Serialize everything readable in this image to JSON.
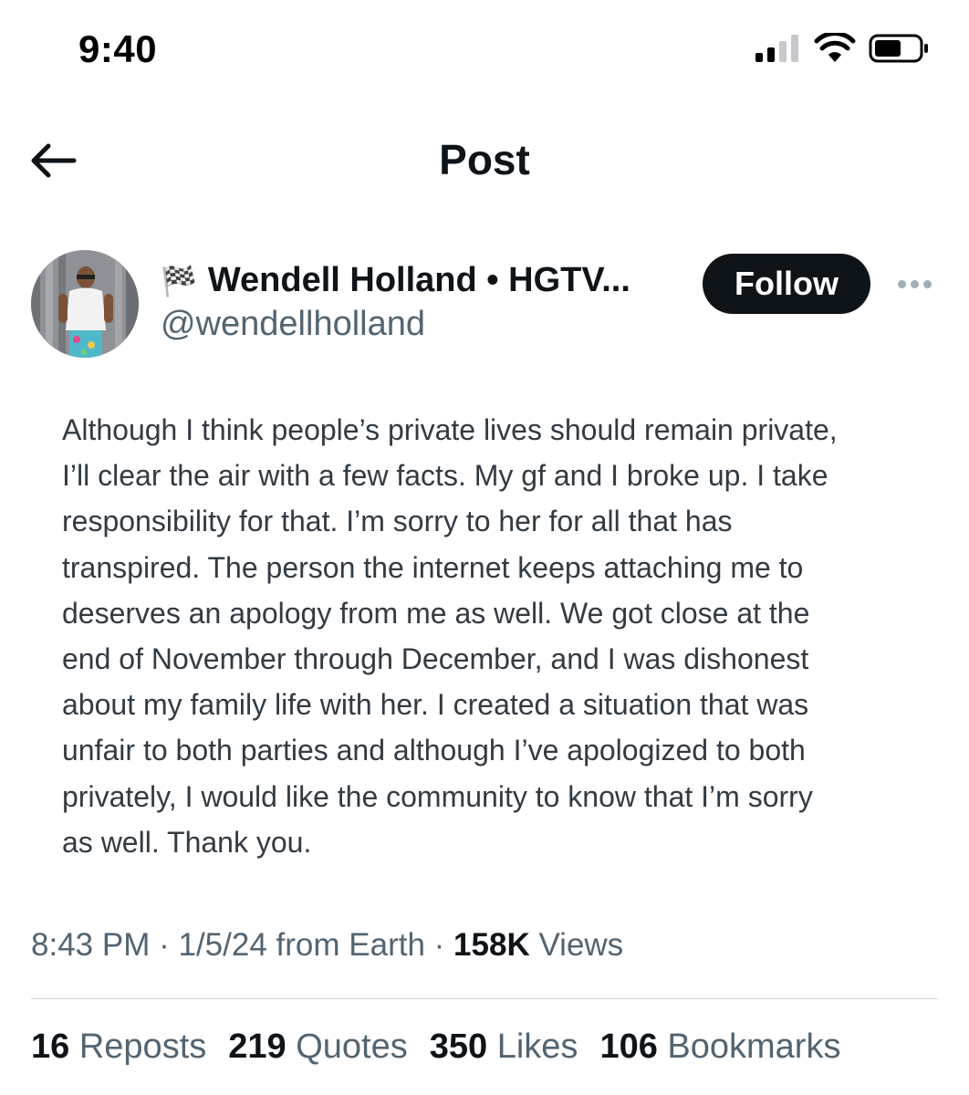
{
  "status_bar": {
    "time": "9:40",
    "icons": [
      "cellular-signal-icon",
      "wifi-icon",
      "battery-icon"
    ]
  },
  "header": {
    "back_icon": "arrow-left-icon",
    "title": "Post"
  },
  "author": {
    "flag_emoji": "🏁",
    "display_name": "Wendell Holland • HGTV...",
    "handle": "@wendellholland",
    "follow_label": "Follow",
    "more_icon": "ellipsis-icon"
  },
  "post": {
    "lines": [
      "Although I think people’s private lives should remain private,",
      "I’ll clear the air with a few facts. My gf and I broke up. I take",
      "responsibility for that. I’m sorry to her for all that has",
      "transpired. The person the internet keeps attaching me to",
      "deserves an apology from me as well. We got close at the",
      "end of November through December, and I was dishonest",
      "about my family life with her. I created a situation that was",
      "unfair to both parties and although I’ve apologized to both",
      "privately, I would like the community to know that I’m sorry",
      "as well.  Thank you."
    ]
  },
  "meta": {
    "time": "8:43 PM",
    "separator": "·",
    "date": "1/5/24",
    "source": "from Earth",
    "views_count": "158K",
    "views_label": "Views"
  },
  "stats": {
    "reposts_count": "16",
    "reposts_label": "Reposts",
    "quotes_count": "219",
    "quotes_label": "Quotes",
    "likes_count": "350",
    "likes_label": "Likes",
    "bookmarks_count": "106",
    "bookmarks_label": "Bookmarks"
  },
  "colors": {
    "text_primary": "#0f1419",
    "text_secondary": "#536471",
    "post_text": "#333b42",
    "follow_bg": "#0f1419",
    "divider": "#cfd9de"
  }
}
